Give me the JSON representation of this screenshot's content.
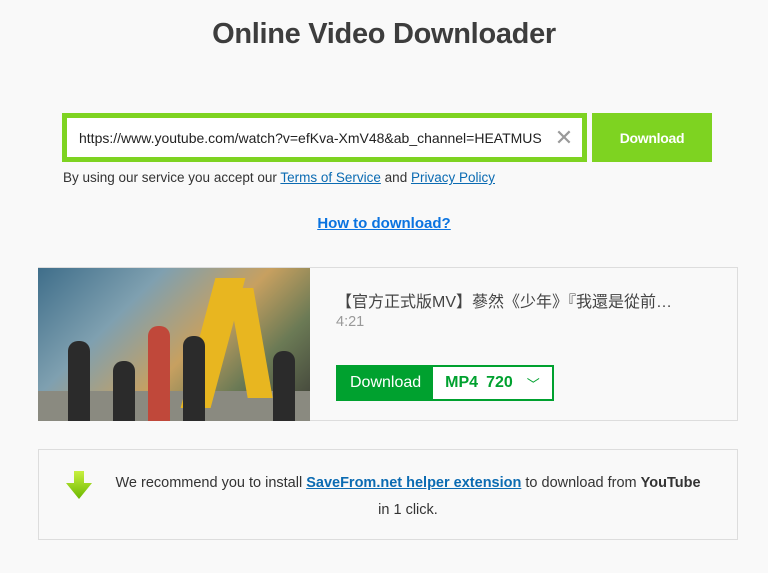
{
  "header": {
    "title": "Online Video Downloader"
  },
  "search": {
    "url": "https://www.youtube.com/watch?v=efKva-XmV48&ab_channel=HEATMUS",
    "clear_icon": "close-icon",
    "download_label": "Download"
  },
  "terms": {
    "prefix": "By using our service you accept our",
    "tos": "Terms of Service",
    "and": "and",
    "privacy": "Privacy Policy"
  },
  "how_to": "How to download?",
  "result": {
    "title": "【官方正式版MV】蔘然《少年》『我還是從前…",
    "duration": "4:21",
    "download_label": "Download",
    "format": "MP4",
    "quality": "720",
    "chevron_icon": "chevron-down-icon"
  },
  "recommend": {
    "text1": "We recommend you to install",
    "link": "SaveFrom.net helper extension",
    "text2": "to download from",
    "brand": "YouTube",
    "text3": "in 1 click.",
    "icon": "download-arrow-icon"
  },
  "colors": {
    "accent": "#7ed321",
    "download_green": "#00a12f",
    "link": "#0b6bb2"
  }
}
